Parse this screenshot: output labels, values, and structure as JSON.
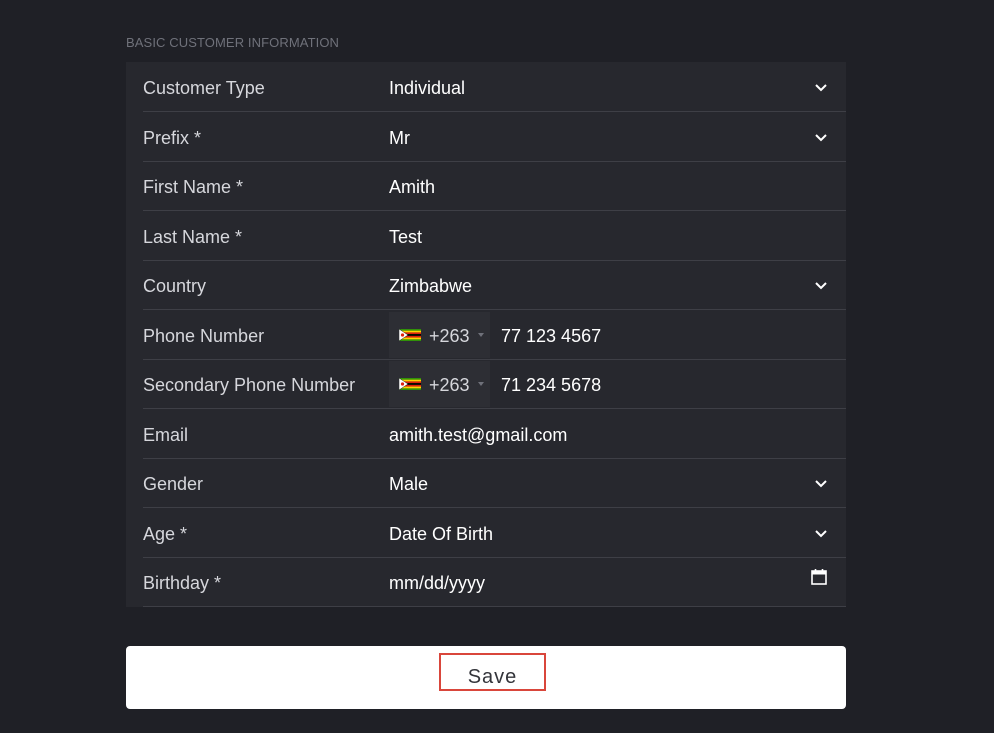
{
  "section": {
    "title": "BASIC CUSTOMER INFORMATION"
  },
  "form": {
    "customer_type": {
      "label": "Customer Type",
      "value": "Individual"
    },
    "prefix": {
      "label": "Prefix *",
      "value": "Mr"
    },
    "first_name": {
      "label": "First Name *",
      "value": "Amith"
    },
    "last_name": {
      "label": "Last Name *",
      "value": "Test"
    },
    "country": {
      "label": "Country",
      "value": "Zimbabwe"
    },
    "phone": {
      "label": "Phone Number",
      "country_code": "+263",
      "number": "77 123 4567"
    },
    "secondary_phone": {
      "label": "Secondary Phone Number",
      "country_code": "+263",
      "number": "71 234 5678"
    },
    "email": {
      "label": "Email",
      "value": "amith.test@gmail.com"
    },
    "gender": {
      "label": "Gender",
      "value": "Male"
    },
    "age": {
      "label": "Age *",
      "value": "Date Of Birth"
    },
    "birthday": {
      "label": "Birthday *",
      "placeholder": "mm/dd/yyyy"
    }
  },
  "actions": {
    "save_label": "Save"
  },
  "colors": {
    "page_bg": "#1f2026",
    "card_bg": "#27282e",
    "save_outline": "#d9463b"
  },
  "icons": {
    "dropdown": "chevron-down-icon",
    "calendar": "calendar-icon",
    "flag": "zimbabwe-flag-icon"
  }
}
